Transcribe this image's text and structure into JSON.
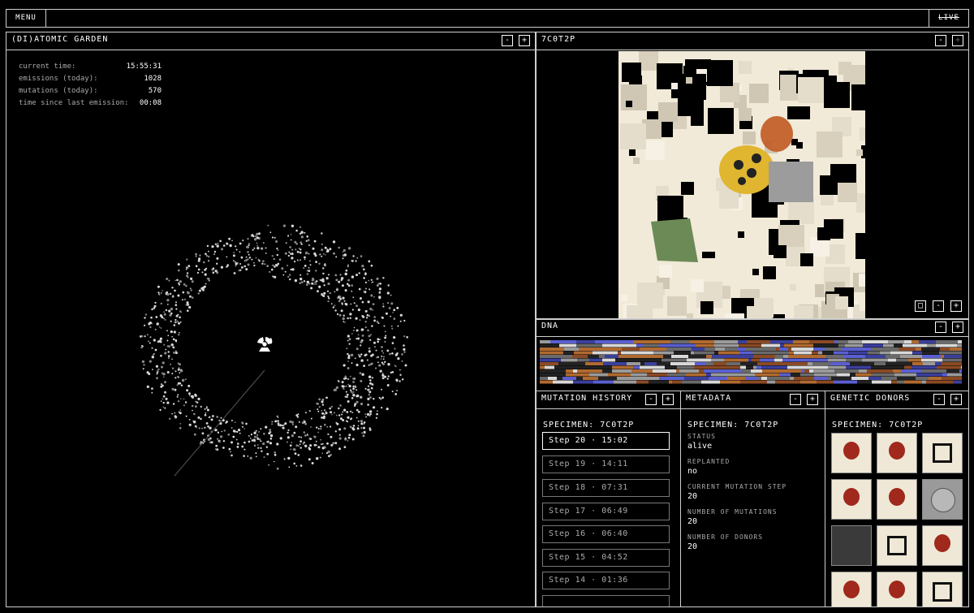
{
  "topbar": {
    "menu_label": "MENU",
    "live_label": "LIVE"
  },
  "garden": {
    "title": "(DI)ATOMIC GARDEN",
    "minimize": "-",
    "maximize": "+",
    "stats": [
      {
        "label": "current time:",
        "value": "15:55:31"
      },
      {
        "label": "emissions (today):",
        "value": "1028"
      },
      {
        "label": "mutations (today):",
        "value": "570"
      },
      {
        "label": "time since last emission:",
        "value": "00:08"
      }
    ],
    "center_icon": "radiation-icon"
  },
  "specimen_panel": {
    "title": "7C0T2P",
    "minimize": "-",
    "maximize": "+",
    "frame_btn": "□"
  },
  "dna": {
    "title": "DNA",
    "minimize": "-",
    "maximize": "+"
  },
  "mutation_history": {
    "title": "MUTATION HISTORY",
    "minimize": "-",
    "maximize": "+",
    "specimen": "SPECIMEN: 7C0T2P",
    "steps": [
      {
        "label": "Step 20 · 15:02",
        "active": true
      },
      {
        "label": "Step 19 · 14:11",
        "active": false
      },
      {
        "label": "Step 18 · 07:31",
        "active": false
      },
      {
        "label": "Step 17 · 06:49",
        "active": false
      },
      {
        "label": "Step 16 · 06:40",
        "active": false
      },
      {
        "label": "Step 15 · 04:52",
        "active": false
      },
      {
        "label": "Step 14 · 01:36",
        "active": false
      }
    ]
  },
  "metadata": {
    "title": "METADATA",
    "minimize": "-",
    "maximize": "+",
    "specimen": "SPECIMEN: 7C0T2P",
    "fields": [
      {
        "label": "STATUS",
        "value": "alive"
      },
      {
        "label": "REPLANTED",
        "value": "no"
      },
      {
        "label": "CURRENT MUTATION STEP",
        "value": "20"
      },
      {
        "label": "NUMBER OF MUTATIONS",
        "value": "20"
      },
      {
        "label": "NUMBER OF DONORS",
        "value": "20"
      }
    ]
  },
  "donors": {
    "title": "GENETIC DONORS",
    "minimize": "-",
    "maximize": "+",
    "specimen": "SPECIMEN: 7C0T2P",
    "colors": {
      "red": "#a0281c",
      "cream": "#efe8d6",
      "gray": "#9a9a9a",
      "dark": "#3a3a3a"
    }
  }
}
